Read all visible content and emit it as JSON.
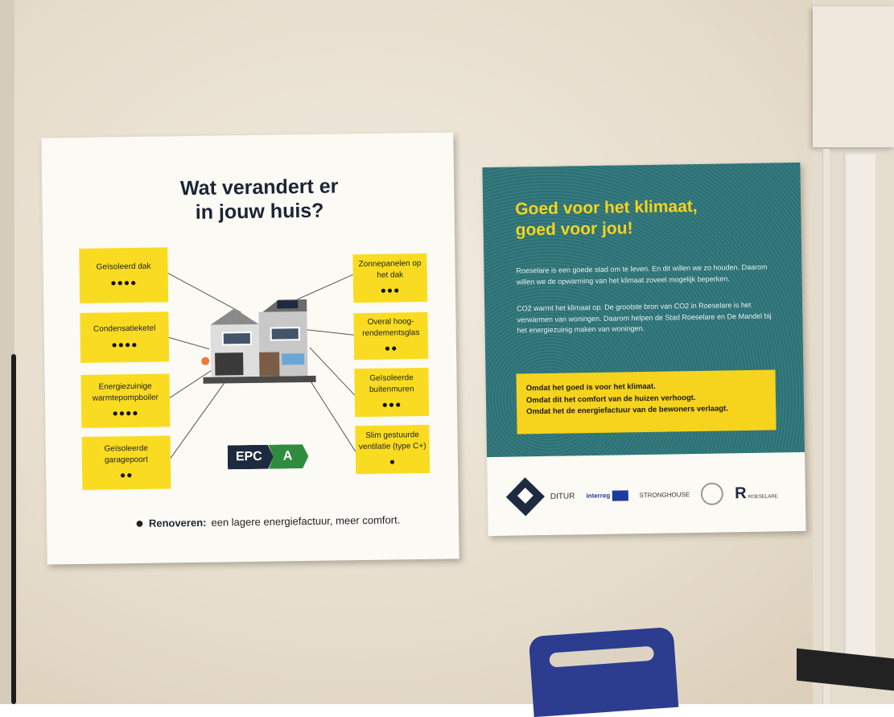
{
  "scene": {
    "colors": {
      "wall": "#ebe3d5",
      "navy": "#1c2434",
      "yellow": "#f9dc21",
      "teal": "#357c80",
      "green": "#2f8c3f"
    }
  },
  "poster_left": {
    "title_line1": "Wat verandert er",
    "title_line2": "in jouw huis?",
    "boxes_left": [
      {
        "label": "Geïsoleerd dak",
        "coins": "●●●●"
      },
      {
        "label": "Condensatieketel",
        "coins": "●●●●"
      },
      {
        "label": "Energiezuinige warmtepompboiler",
        "coins": "●●●●"
      },
      {
        "label": "Geïsoleerde garagepoort",
        "coins": "●●"
      }
    ],
    "boxes_right": [
      {
        "label": "Zonnepanelen op het dak",
        "coins": "●●●"
      },
      {
        "label": "Overal hoog-rendementsglas",
        "coins": "●●"
      },
      {
        "label": "Geïsoleerde buitenmuren",
        "coins": "●●●"
      },
      {
        "label": "Slim gestuurde ventilatie (type C+)",
        "coins": "●"
      }
    ],
    "epc_label": "EPC",
    "epc_grade": "A",
    "footer_bold": "Renoveren:",
    "footer_rest": "een lagere energiefactuur, meer comfort."
  },
  "poster_right": {
    "title_line1": "Goed voor het klimaat,",
    "title_line2": "goed voor jou!",
    "para1": "Roeselare is een goede stad om te leven. En dit willen we zo houden. Daarom willen we de opwarming van het klimaat zoveel mogelijk beperken.",
    "para2": "CO2 warmt het klimaat op. De grootste bron van CO2 in Roeselare is het verwarmen van woningen. Daarom helpen de Stad Roeselare en De Mandel bij het energiezuinig maken van woningen.",
    "band_line1": "Omdat het goed is voor het klimaat.",
    "band_line2": "Omdat dit het comfort van de huizen verhoogt.",
    "band_line3": "Omdat het de energiefactuur van de bewoners verlaagt.",
    "logo_ditur": "DITUR",
    "logo_interreg": "interreg",
    "logo_stronghouse": "STRONGHOUSE",
    "logo_roeselare": "ROESELARE"
  }
}
